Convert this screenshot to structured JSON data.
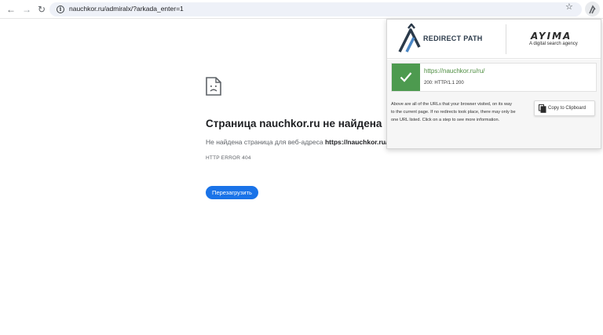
{
  "browser": {
    "url": "nauchkor.ru/admiralx/?arkada_enter=1",
    "back_icon": "arrow-left",
    "forward_icon": "arrow-right",
    "reload_icon": "reload"
  },
  "error_page": {
    "title": "Страница nauchkor.ru не найдена",
    "description_prefix": "Не найдена страница для веб-адреса ",
    "description_url": "https://nauchkor.ru/a",
    "error_code": "HTTP ERROR 404",
    "reload_button": "Перезагрузить"
  },
  "redirect_path": {
    "brand": "REDIRECT PATH",
    "ayima_logo": "AYIMA",
    "ayima_tagline": "A digital search agency",
    "result": {
      "url": "https://nauchkor.ru/ru/",
      "status": "200: HTTP/1.1 200",
      "status_color": "#4d9a4f"
    },
    "info_text": "Above are all of the URLs that your browser visited, on its way to the current page. If no redirects took place, there may only be one URL listed. Click on a step to see more information.",
    "copy_button": "Copy to Clipboard"
  },
  "colors": {
    "accent_blue": "#1a73e8",
    "success_green": "#4d9a4f",
    "url_green": "#4c8c3f"
  }
}
